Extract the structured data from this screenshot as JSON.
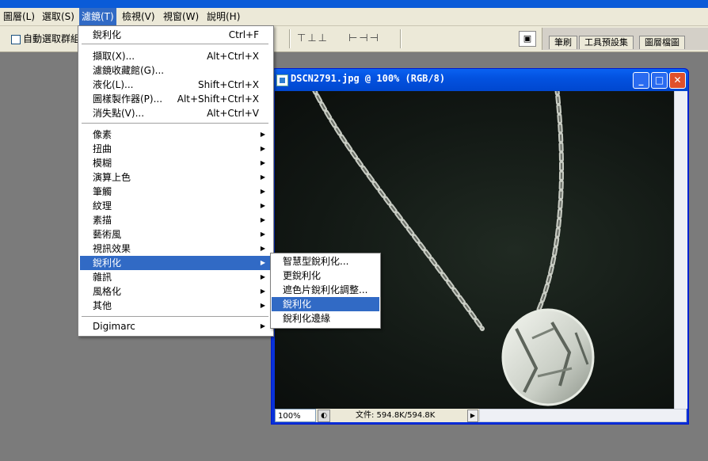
{
  "menubar": {
    "items": [
      {
        "label": "圖層(L)"
      },
      {
        "label": "選取(S)"
      },
      {
        "label": "濾鏡(T)"
      },
      {
        "label": "檢視(V)"
      },
      {
        "label": "視窗(W)"
      },
      {
        "label": "說明(H)"
      }
    ]
  },
  "toolbar": {
    "auto_select_label": "自動選取群組",
    "palette_tabs": [
      "筆刷",
      "工具預設集",
      "圖層檔圖"
    ]
  },
  "document": {
    "title": "DSCN2791.jpg @ 100% (RGB/8)",
    "zoom": "100%",
    "file_info": "文件: 594.8K/594.8K"
  },
  "filter_menu": {
    "top": [
      {
        "label": "銳利化",
        "shortcut": "Ctrl+F"
      }
    ],
    "group1": [
      {
        "label": "擷取(X)...",
        "shortcut": "Alt+Ctrl+X"
      },
      {
        "label": "濾鏡收藏館(G)...",
        "shortcut": ""
      },
      {
        "label": "液化(L)...",
        "shortcut": "Shift+Ctrl+X"
      },
      {
        "label": "圖樣製作器(P)...",
        "shortcut": "Alt+Shift+Ctrl+X"
      },
      {
        "label": "消失點(V)...",
        "shortcut": "Alt+Ctrl+V"
      }
    ],
    "submenus": [
      {
        "label": "像素"
      },
      {
        "label": "扭曲"
      },
      {
        "label": "模糊"
      },
      {
        "label": "演算上色"
      },
      {
        "label": "筆觸"
      },
      {
        "label": "紋理"
      },
      {
        "label": "素描"
      },
      {
        "label": "藝術風"
      },
      {
        "label": "視訊效果"
      },
      {
        "label": "銳利化"
      },
      {
        "label": "雜訊"
      },
      {
        "label": "風格化"
      },
      {
        "label": "其他"
      }
    ],
    "bottom": [
      {
        "label": "Digimarc"
      }
    ]
  },
  "sharpen_submenu": {
    "items": [
      {
        "label": "智慧型銳利化..."
      },
      {
        "label": "更銳利化"
      },
      {
        "label": "遮色片銳利化調整..."
      },
      {
        "label": "銳利化"
      },
      {
        "label": "銳利化邊緣"
      }
    ]
  }
}
